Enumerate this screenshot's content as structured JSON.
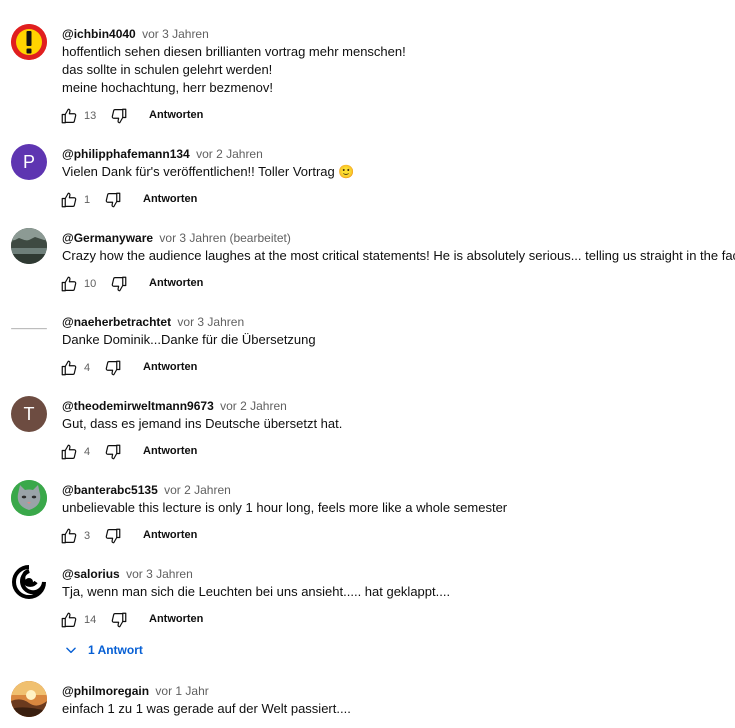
{
  "reply_label": "Antworten",
  "comments": [
    {
      "author": "@ichbin4040",
      "meta": "vor 3 Jahren",
      "lines": [
        "hoffentlich sehen diesen brillianten vortrag mehr menschen!",
        "das sollte in schulen gelehrt werden!",
        "meine hochachtung, herr bezmenov!"
      ],
      "likes": "13",
      "avatar": {
        "kind": "warning-icon",
        "bg": "#e01f1f"
      }
    },
    {
      "author": "@philipphafemann134",
      "meta": "vor 2 Jahren",
      "lines": [
        "Vielen Dank für's veröffentlichen!! Toller Vortrag 🙂"
      ],
      "likes": "1",
      "avatar": {
        "kind": "letter",
        "letter": "P",
        "bg": "#5e35b1"
      }
    },
    {
      "author": "@Germanyware",
      "meta": "vor 3 Jahren (bearbeitet)",
      "lines": [
        "Crazy how the audience laughes at the most critical statements! He is absolutely serious... telling us straight in the face."
      ],
      "likes": "10",
      "avatar": {
        "kind": "landscape-photo",
        "bg": "#4a5548"
      }
    },
    {
      "author": "@naeherbetrachtet",
      "meta": "vor 3 Jahren",
      "lines": [
        "Danke Dominik...Danke für die Übersetzung"
      ],
      "likes": "4",
      "avatar": {
        "kind": "text-logo",
        "bg": "#ffffff"
      }
    },
    {
      "author": "@theodemirweltmann9673",
      "meta": "vor 2 Jahren",
      "lines": [
        "Gut, dass es jemand ins Deutsche übersetzt hat."
      ],
      "likes": "4",
      "avatar": {
        "kind": "letter",
        "letter": "T",
        "bg": "#6d4c41"
      }
    },
    {
      "author": "@banterabc5135",
      "meta": "vor 2 Jahren",
      "lines": [
        "unbelievable this lecture is only 1 hour long, feels more like a whole semester"
      ],
      "likes": "3",
      "avatar": {
        "kind": "cat-photo",
        "bg": "#3aa84a"
      }
    },
    {
      "author": "@salorius",
      "meta": "vor 3 Jahren",
      "lines": [
        "Tja, wenn man sich die Leuchten bei uns ansieht..... hat geklappt...."
      ],
      "likes": "14",
      "avatar": {
        "kind": "swirl-logo",
        "bg": "#ffffff"
      }
    },
    {
      "author": "@philmoregain",
      "meta": "vor 1 Jahr",
      "lines": [
        "einfach 1 zu 1 was gerade auf der Welt passiert...."
      ],
      "likes": "",
      "avatar": {
        "kind": "sunset-photo",
        "bg": "#b5652e"
      }
    }
  ],
  "replies_toggle": {
    "label": "1 Antwort",
    "color": "#065fd4"
  }
}
